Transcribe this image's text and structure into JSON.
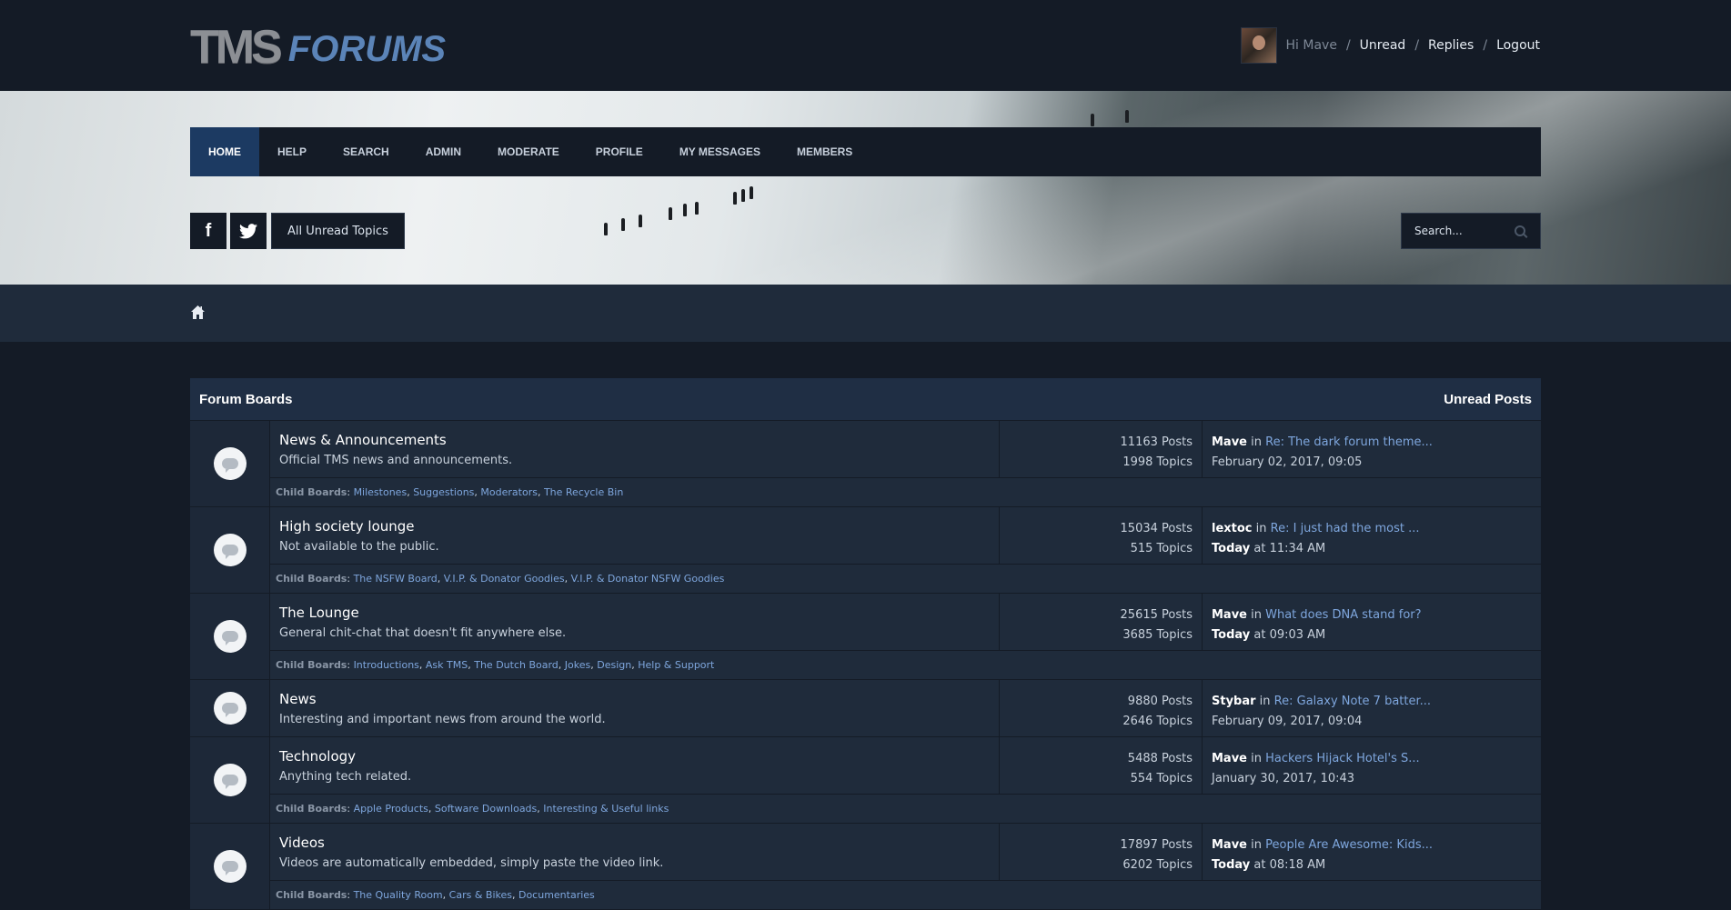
{
  "header": {
    "logo_main": "TMS",
    "logo_sub": "FORUMS",
    "greeting": "Hi Mave",
    "links": [
      "Unread",
      "Replies",
      "Logout"
    ],
    "sep": "/"
  },
  "nav": [
    "HOME",
    "HELP",
    "SEARCH",
    "ADMIN",
    "MODERATE",
    "PROFILE",
    "MY MESSAGES",
    "MEMBERS"
  ],
  "toolbar": {
    "facebook": "f",
    "unread_topics": "All Unread Topics",
    "search_placeholder": "Search..."
  },
  "boards_header": {
    "left": "Forum Boards",
    "right": "Unread Posts"
  },
  "child_label": "Child Boards",
  "boards": [
    {
      "name": "News & Announcements",
      "desc": "Official TMS news and announcements.",
      "posts": "11163 Posts",
      "topics": "1998 Topics",
      "last_user": "Mave",
      "last_title": "Re: The dark forum theme...",
      "last_day": "",
      "last_time": "February 02, 2017, 09:05",
      "children": [
        "Milestones",
        "Suggestions",
        "Moderators",
        "The Recycle Bin"
      ]
    },
    {
      "name": "High society lounge",
      "desc": "Not available to the public.",
      "posts": "15034 Posts",
      "topics": "515 Topics",
      "last_user": "lextoc",
      "last_title": "Re: I just had the most ...",
      "last_day": "Today",
      "last_time": " at 11:34 AM",
      "children": [
        "The NSFW Board",
        "V.I.P. & Donator Goodies",
        "V.I.P. & Donator NSFW Goodies"
      ]
    },
    {
      "name": "The Lounge",
      "desc": "General chit-chat that doesn't fit anywhere else.",
      "posts": "25615 Posts",
      "topics": "3685 Topics",
      "last_user": "Mave",
      "last_title": "What does DNA stand for?",
      "last_day": "Today",
      "last_time": " at 09:03 AM",
      "children": [
        "Introductions",
        "Ask TMS",
        "The Dutch Board",
        "Jokes",
        "Design",
        "Help & Support"
      ]
    },
    {
      "name": "News",
      "desc": "Interesting and important news from around the world.",
      "posts": "9880 Posts",
      "topics": "2646 Topics",
      "last_user": "Stybar",
      "last_title": "Re: Galaxy Note 7 batter...",
      "last_day": "",
      "last_time": "February 09, 2017, 09:04",
      "children": []
    },
    {
      "name": "Technology",
      "desc": "Anything tech related.",
      "posts": "5488 Posts",
      "topics": "554 Topics",
      "last_user": "Mave",
      "last_title": "Hackers Hijack Hotel's S...",
      "last_day": "",
      "last_time": "January 30, 2017, 10:43",
      "children": [
        "Apple Products",
        "Software Downloads",
        "Interesting & Useful links"
      ]
    },
    {
      "name": "Videos",
      "desc": "Videos are automatically embedded, simply paste the video link.",
      "posts": "17897 Posts",
      "topics": "6202 Topics",
      "last_user": "Mave",
      "last_title": "People Are Awesome: Kids...",
      "last_day": "Today",
      "last_time": " at 08:18 AM",
      "children": [
        "The Quality Room",
        "Cars & Bikes",
        "Documentaries"
      ]
    }
  ]
}
